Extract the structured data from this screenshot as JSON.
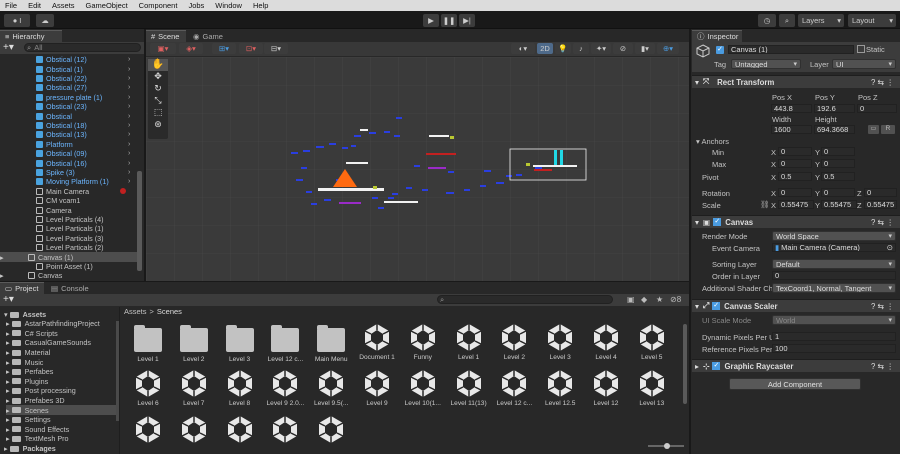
{
  "menu": [
    "File",
    "Edit",
    "Assets",
    "GameObject",
    "Component",
    "Jobs",
    "Window",
    "Help"
  ],
  "toolbar": {
    "account_label": "I",
    "layers_label": "Layers",
    "layout_label": "Layout"
  },
  "hierarchy": {
    "tab": "Hierarchy",
    "search_placeholder": "All",
    "items": [
      {
        "label": "Obstical (12)",
        "blue": true
      },
      {
        "label": "Obstical (1)",
        "blue": true
      },
      {
        "label": "Obstical (22)",
        "blue": true
      },
      {
        "label": "Obstical (27)",
        "blue": true
      },
      {
        "label": "pressure plate (1)",
        "blue": true
      },
      {
        "label": "Obstical (23)",
        "blue": true
      },
      {
        "label": "Obstical",
        "blue": true
      },
      {
        "label": "Obstical (18)",
        "blue": true
      },
      {
        "label": "Obstical (13)",
        "blue": true
      },
      {
        "label": "Platform",
        "blue": true
      },
      {
        "label": "Obstical (09)",
        "blue": true
      },
      {
        "label": "Obstical (16)",
        "blue": true
      },
      {
        "label": "Spike (3)",
        "blue": true
      },
      {
        "label": "Moving Platform (1)",
        "blue": true
      },
      {
        "label": "Main Camera",
        "blue": false
      },
      {
        "label": "CM vcam1",
        "blue": false
      },
      {
        "label": "Camera",
        "blue": false
      },
      {
        "label": "Level Particals (4)",
        "blue": false
      },
      {
        "label": "Level Particals (1)",
        "blue": false
      },
      {
        "label": "Level Particals (3)",
        "blue": false
      },
      {
        "label": "Level Particals (2)",
        "blue": false
      },
      {
        "label": "Canvas (1)",
        "blue": false
      },
      {
        "label": "Point Asset (1)",
        "blue": false
      },
      {
        "label": "Canvas",
        "blue": false
      }
    ]
  },
  "scene": {
    "tab": "Scene",
    "game_tab": "Game",
    "mode_2d": "2D"
  },
  "project": {
    "tab": "Project",
    "console_tab": "Console",
    "breadcrumb_root": "Assets",
    "breadcrumb_sep": ">",
    "breadcrumb_current": "Scenes",
    "hidden_count": "8",
    "tree_root": "Assets",
    "tree": [
      "AstarPathfindingProject",
      "C# Scripts",
      "CasualGameSounds",
      "Material",
      "Music",
      "Perfabes",
      "Plugins",
      "Post processing",
      "Prefabes 3D",
      "Scenes",
      "Settings",
      "Sound Effects",
      "TextMesh Pro"
    ],
    "packages": "Packages",
    "row1": [
      {
        "label": "Level 1",
        "type": "folder"
      },
      {
        "label": "Level 2",
        "type": "folder"
      },
      {
        "label": "Level 3",
        "type": "folder"
      },
      {
        "label": "Level 12 c...",
        "type": "folder"
      },
      {
        "label": "Main Menu",
        "type": "folder"
      },
      {
        "label": "Document 1",
        "type": "unity"
      },
      {
        "label": "Funny",
        "type": "unity"
      },
      {
        "label": "Level 1",
        "type": "unity"
      },
      {
        "label": "Level 2",
        "type": "unity"
      },
      {
        "label": "Level 3",
        "type": "unity"
      },
      {
        "label": "Level 4",
        "type": "unity"
      },
      {
        "label": "Level 5",
        "type": "unity"
      }
    ],
    "row2": [
      {
        "label": "Level 6",
        "type": "unity"
      },
      {
        "label": "Level 7",
        "type": "unity"
      },
      {
        "label": "Level 8",
        "type": "unity"
      },
      {
        "label": "Level 9 2.0...",
        "type": "unity"
      },
      {
        "label": "Level 9.5(...",
        "type": "unity"
      },
      {
        "label": "Level 9",
        "type": "unity"
      },
      {
        "label": "Level 10(1...",
        "type": "unity"
      },
      {
        "label": "Level 11(13)",
        "type": "unity"
      },
      {
        "label": "Level 12 c...",
        "type": "unity"
      },
      {
        "label": "Level 12.5",
        "type": "unity"
      },
      {
        "label": "Level 12",
        "type": "unity"
      },
      {
        "label": "Level 13",
        "type": "unity"
      }
    ]
  },
  "inspector": {
    "tab": "Inspector",
    "object_name": "Canvas (1)",
    "static_label": "Static",
    "tag_label": "Tag",
    "tag_value": "Untagged",
    "layer_label": "Layer",
    "layer_value": "UI",
    "rect": {
      "title": "Rect Transform",
      "pos_x_label": "Pos X",
      "pos_y_label": "Pos Y",
      "pos_z_label": "Pos Z",
      "pos_x": "443.8",
      "pos_y": "192.6",
      "pos_z": "0",
      "width_label": "Width",
      "height_label": "Height",
      "width": "1600",
      "height": "694.3668",
      "btn_r": "R",
      "anchors_label": "Anchors",
      "min_label": "Min",
      "max_label": "Max",
      "pivot_label": "Pivot",
      "ax": "X",
      "ay": "Y",
      "az": "Z",
      "min_x": "0",
      "min_y": "0",
      "max_x": "0",
      "max_y": "0",
      "pivot_x": "0.5",
      "pivot_y": "0.5",
      "rotation_label": "Rotation",
      "rot_x": "0",
      "rot_y": "0",
      "rot_z": "0",
      "scale_label": "Scale",
      "scale_x": "0.55475",
      "scale_y": "0.55475",
      "scale_z": "0.55475"
    },
    "canvas": {
      "title": "Canvas",
      "render_mode_label": "Render Mode",
      "render_mode": "World Space",
      "event_camera_label": "Event Camera",
      "event_camera": "Main Camera (Camera)",
      "sorting_layer_label": "Sorting Layer",
      "sorting_layer": "Default",
      "order_label": "Order in Layer",
      "order": "0",
      "shader_label": "Additional Shader Ch",
      "shader": "TexCoord1, Normal, Tangent"
    },
    "scaler": {
      "title": "Canvas Scaler",
      "ui_scale_label": "UI Scale Mode",
      "ui_scale": "World",
      "dyn_label": "Dynamic Pixels Per U",
      "dyn": "1",
      "ref_label": "Reference Pixels Per",
      "ref": "100"
    },
    "raycaster": {
      "title": "Graphic Raycaster"
    },
    "add_component": "Add Component"
  }
}
